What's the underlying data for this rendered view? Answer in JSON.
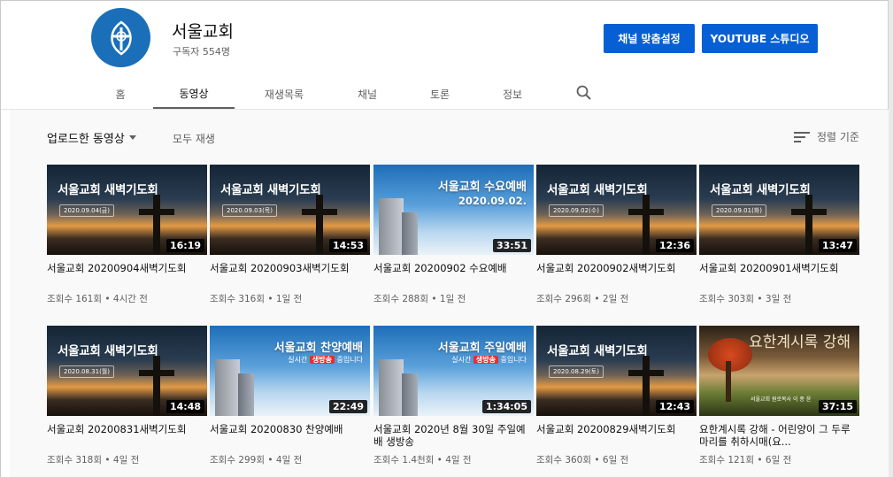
{
  "channel": {
    "name": "서울교회",
    "subscribers": "구독자 554명",
    "customize_label": "채널 맞춤설정",
    "studio_label": "YOUTUBE 스튜디오",
    "brand_color": "#065fd4",
    "avatar_color": "#1a6fb8"
  },
  "tabs": [
    {
      "label": "홈"
    },
    {
      "label": "동영상",
      "active": true
    },
    {
      "label": "재생목록"
    },
    {
      "label": "채널"
    },
    {
      "label": "토론"
    },
    {
      "label": "정보"
    }
  ],
  "filter": {
    "uploads_label": "업로드한 동영상",
    "play_all_label": "모두 재생",
    "sort_label": "정렬 기준"
  },
  "videos": [
    {
      "style": "dawn",
      "thumb_title": "서울교회 새벽기도회",
      "thumb_date": "2020.09.04(금)",
      "duration": "16:19",
      "title": "서울교회 20200904새벽기도회",
      "meta": "조회수 161회 • 4시간 전"
    },
    {
      "style": "dawn",
      "thumb_title": "서울교회 새벽기도회",
      "thumb_date": "2020.09.03(목)",
      "duration": "14:53",
      "title": "서울교회 20200903새벽기도회",
      "meta": "조회수 316회 • 1일 전"
    },
    {
      "style": "sky",
      "thumb_title": "서울교회 수요예배",
      "thumb_sub": "2020.09.02.",
      "duration": "33:51",
      "title": "서울교회 20200902 수요예배",
      "meta": "조회수 288회 • 1일 전"
    },
    {
      "style": "dawn",
      "thumb_title": "서울교회 새벽기도회",
      "thumb_date": "2020.09.02(수)",
      "duration": "12:36",
      "title": "서울교회 20200902새벽기도회",
      "meta": "조회수 296회 • 2일 전"
    },
    {
      "style": "dawn",
      "thumb_title": "서울교회 새벽기도회",
      "thumb_date": "2020.09.01(화)",
      "duration": "13:47",
      "title": "서울교회 20200901새벽기도회",
      "meta": "조회수 303회 • 3일 전"
    },
    {
      "style": "dawn",
      "thumb_title": "서울교회 새벽기도회",
      "thumb_date": "2020.08.31(월)",
      "duration": "14:48",
      "title": "서울교회 20200831새벽기도회",
      "meta": "조회수 318회 • 4일 전"
    },
    {
      "style": "sky-live",
      "thumb_title": "서울교회 찬양예배",
      "live_pre": "실시간",
      "live_tag": "생방송",
      "live_post": "중입니다",
      "duration": "22:49",
      "title": "서울교회 20200830 찬양예배",
      "meta": "조회수 299회 • 4일 전"
    },
    {
      "style": "sky-live",
      "thumb_title": "서울교회 주일예배",
      "live_pre": "실시간",
      "live_tag": "생방송",
      "live_post": "중입니다",
      "duration": "1:34:05",
      "title": "서울교회 2020년 8월 30일 주일예배 생방송",
      "meta": "조회수 1.4천회 • 4일 전"
    },
    {
      "style": "dawn",
      "thumb_title": "서울교회 새벽기도회",
      "thumb_date": "2020.08.29(토)",
      "duration": "12:43",
      "title": "서울교회 20200829새벽기도회",
      "meta": "조회수 360회 • 6일 전"
    },
    {
      "style": "tree",
      "thumb_title": "요한계시록 강해",
      "thumb_sub": "서울교회 원로목사 이 종 윤",
      "duration": "37:15",
      "title": "요한계시록 강해 - 어린양이 그 두루마리를 취하시매(요...",
      "meta": "조회수 121회 • 6일 전"
    }
  ]
}
